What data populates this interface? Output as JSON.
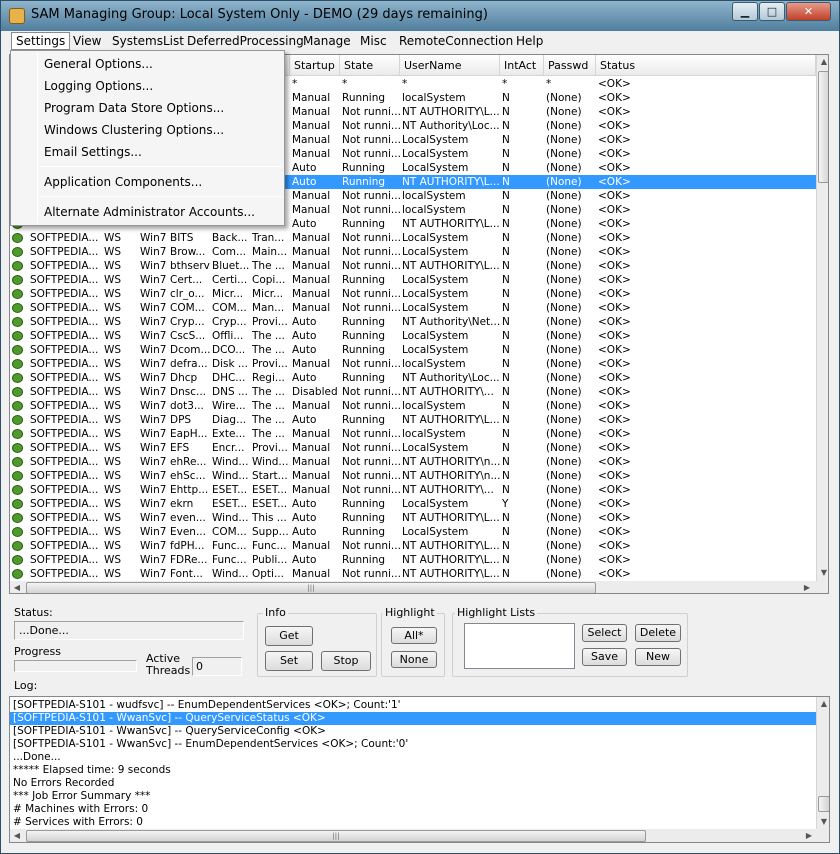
{
  "window": {
    "title": "SAM Managing Group: Local System Only - DEMO (29 days remaining)",
    "minimize": "▁",
    "maximize": "□",
    "close": "✕"
  },
  "menubar": [
    "Settings",
    "View",
    "SystemsList",
    "DeferredProcessing",
    "Manage",
    "Misc",
    "RemoteConnection",
    "Help"
  ],
  "settings_menu": [
    "General Options...",
    "Logging Options...",
    "Program Data Store Options...",
    "Windows Clustering Options...",
    "Email Settings...",
    "Application Components...",
    "Alternate Administrator Accounts..."
  ],
  "grid": {
    "columns": [
      "",
      "",
      "",
      "",
      "",
      "",
      "Startup",
      "State",
      "UserName",
      "IntAct",
      "Passwd",
      "Status"
    ],
    "filter_row": [
      "",
      "",
      "",
      "",
      "",
      "",
      "*",
      "*",
      "*",
      "*",
      "*",
      "<OK>"
    ],
    "rows": [
      [
        "",
        "",
        "",
        "",
        "",
        "",
        "Manual",
        "Running",
        "localSystem",
        "N",
        "(None)",
        "<OK>"
      ],
      [
        "",
        "",
        "",
        "",
        "",
        "",
        "Manual",
        "Not runni...",
        "NT AUTHORITY\\L...",
        "N",
        "(None)",
        "<OK>"
      ],
      [
        "",
        "",
        "",
        "",
        "",
        "",
        "Manual",
        "Not runni...",
        "NT Authority\\Loc...",
        "N",
        "(None)",
        "<OK>"
      ],
      [
        "",
        "",
        "",
        "",
        "",
        "",
        "Manual",
        "Not runni...",
        "LocalSystem",
        "N",
        "(None)",
        "<OK>"
      ],
      [
        "",
        "",
        "",
        "",
        "",
        "",
        "Manual",
        "Not runni...",
        "LocalSystem",
        "N",
        "(None)",
        "<OK>"
      ],
      [
        "",
        "",
        "",
        "",
        "",
        "",
        "Auto",
        "Running",
        "LocalSystem",
        "N",
        "(None)",
        "<OK>"
      ],
      [
        "",
        "",
        "",
        "",
        "",
        "",
        "Auto",
        "Running",
        "NT AUTHORITY\\L...",
        "N",
        "(None)",
        "<OK>"
      ],
      [
        "",
        "",
        "",
        "",
        "",
        "",
        "Manual",
        "Not runni...",
        "localSystem",
        "N",
        "(None)",
        "<OK>"
      ],
      [
        "",
        "",
        "",
        "",
        "",
        "",
        "Manual",
        "Not runni...",
        "localSystem",
        "N",
        "(None)",
        "<OK>"
      ],
      [
        "",
        "",
        "",
        "",
        "",
        "",
        "Auto",
        "Running",
        "NT AUTHORITY\\L...",
        "N",
        "(None)",
        "<OK>"
      ],
      [
        "SOFTPEDIA...",
        "WS",
        "Win7",
        "BITS",
        "Back...",
        "Tran...",
        "Manual",
        "Not runni...",
        "LocalSystem",
        "N",
        "(None)",
        "<OK>"
      ],
      [
        "SOFTPEDIA...",
        "WS",
        "Win7",
        "Brow...",
        "Com...",
        "Main...",
        "Manual",
        "Not runni...",
        "LocalSystem",
        "N",
        "(None)",
        "<OK>"
      ],
      [
        "SOFTPEDIA...",
        "WS",
        "Win7",
        "bthserv",
        "Bluet...",
        "The ...",
        "Manual",
        "Not runni...",
        "NT AUTHORITY\\L...",
        "N",
        "(None)",
        "<OK>"
      ],
      [
        "SOFTPEDIA...",
        "WS",
        "Win7",
        "Cert...",
        "Certi...",
        "Copi...",
        "Manual",
        "Running",
        "LocalSystem",
        "N",
        "(None)",
        "<OK>"
      ],
      [
        "SOFTPEDIA...",
        "WS",
        "Win7",
        "clr_o...",
        "Micr...",
        "Micr...",
        "Manual",
        "Not runni...",
        "LocalSystem",
        "N",
        "(None)",
        "<OK>"
      ],
      [
        "SOFTPEDIA...",
        "WS",
        "Win7",
        "COM...",
        "COM...",
        "Man...",
        "Manual",
        "Not runni...",
        "LocalSystem",
        "N",
        "(None)",
        "<OK>"
      ],
      [
        "SOFTPEDIA...",
        "WS",
        "Win7",
        "Cryp...",
        "Cryp...",
        "Provi...",
        "Auto",
        "Running",
        "NT Authority\\Net...",
        "N",
        "(None)",
        "<OK>"
      ],
      [
        "SOFTPEDIA...",
        "WS",
        "Win7",
        "CscS...",
        "Offli...",
        "The ...",
        "Auto",
        "Running",
        "LocalSystem",
        "N",
        "(None)",
        "<OK>"
      ],
      [
        "SOFTPEDIA...",
        "WS",
        "Win7",
        "Dcom...",
        "DCO...",
        "The ...",
        "Auto",
        "Running",
        "LocalSystem",
        "N",
        "(None)",
        "<OK>"
      ],
      [
        "SOFTPEDIA...",
        "WS",
        "Win7",
        "defra...",
        "Disk ...",
        "Provi...",
        "Manual",
        "Not runni...",
        "localSystem",
        "N",
        "(None)",
        "<OK>"
      ],
      [
        "SOFTPEDIA...",
        "WS",
        "Win7",
        "Dhcp",
        "DHC...",
        "Regi...",
        "Auto",
        "Running",
        "NT Authority\\Loc...",
        "N",
        "(None)",
        "<OK>"
      ],
      [
        "SOFTPEDIA...",
        "WS",
        "Win7",
        "Dnsc...",
        "DNS ...",
        "The ...",
        "Disabled",
        "Not runni...",
        "NT AUTHORITY\\...",
        "N",
        "(None)",
        "<OK>"
      ],
      [
        "SOFTPEDIA...",
        "WS",
        "Win7",
        "dot3...",
        "Wire...",
        "The ...",
        "Manual",
        "Not runni...",
        "localSystem",
        "N",
        "(None)",
        "<OK>"
      ],
      [
        "SOFTPEDIA...",
        "WS",
        "Win7",
        "DPS",
        "Diag...",
        "The ...",
        "Auto",
        "Running",
        "NT AUTHORITY\\L...",
        "N",
        "(None)",
        "<OK>"
      ],
      [
        "SOFTPEDIA...",
        "WS",
        "Win7",
        "EapH...",
        "Exte...",
        "The ...",
        "Manual",
        "Not runni...",
        "localSystem",
        "N",
        "(None)",
        "<OK>"
      ],
      [
        "SOFTPEDIA...",
        "WS",
        "Win7",
        "EFS",
        "Encr...",
        "Provi...",
        "Manual",
        "Not runni...",
        "LocalSystem",
        "N",
        "(None)",
        "<OK>"
      ],
      [
        "SOFTPEDIA...",
        "WS",
        "Win7",
        "ehRe...",
        "Wind...",
        "Wind...",
        "Manual",
        "Not runni...",
        "NT AUTHORITY\\n...",
        "N",
        "(None)",
        "<OK>"
      ],
      [
        "SOFTPEDIA...",
        "WS",
        "Win7",
        "ehSc...",
        "Wind...",
        "Start...",
        "Manual",
        "Not runni...",
        "NT AUTHORITY\\n...",
        "N",
        "(None)",
        "<OK>"
      ],
      [
        "SOFTPEDIA...",
        "WS",
        "Win7",
        "Ehttp...",
        "ESET...",
        "ESET...",
        "Manual",
        "Not runni...",
        "NT AUTHORITY\\...",
        "N",
        "(None)",
        "<OK>"
      ],
      [
        "SOFTPEDIA...",
        "WS",
        "Win7",
        "ekrn",
        "ESET...",
        "ESET...",
        "Auto",
        "Running",
        "LocalSystem",
        "Y",
        "(None)",
        "<OK>"
      ],
      [
        "SOFTPEDIA...",
        "WS",
        "Win7",
        "even...",
        "Wind...",
        "This ...",
        "Auto",
        "Running",
        "NT AUTHORITY\\L...",
        "N",
        "(None)",
        "<OK>"
      ],
      [
        "SOFTPEDIA...",
        "WS",
        "Win7",
        "Even...",
        "COM...",
        "Supp...",
        "Auto",
        "Running",
        "LocalSystem",
        "N",
        "(None)",
        "<OK>"
      ],
      [
        "SOFTPEDIA...",
        "WS",
        "Win7",
        "fdPH...",
        "Func...",
        "Func...",
        "Manual",
        "Not runni...",
        "NT AUTHORITY\\L...",
        "N",
        "(None)",
        "<OK>"
      ],
      [
        "SOFTPEDIA...",
        "WS",
        "Win7",
        "FDRe...",
        "Func...",
        "Publi...",
        "Auto",
        "Running",
        "NT AUTHORITY\\L...",
        "N",
        "(None)",
        "<OK>"
      ],
      [
        "SOFTPEDIA...",
        "WS",
        "Win7",
        "Font...",
        "Wind...",
        "Opti...",
        "Manual",
        "Not runni...",
        "NT AUTHORITY\\L...",
        "N",
        "(None)",
        "<OK>"
      ]
    ]
  },
  "status_panel": {
    "status_label": "Status:",
    "status_value": "...Done...",
    "progress_label": "Progress",
    "progress_fraction": 0,
    "active_threads_label": "Active Threads",
    "active_threads_value": "0",
    "log_label": "Log:"
  },
  "info": {
    "legend": "Info",
    "get": "Get",
    "set": "Set",
    "stop": "Stop"
  },
  "highlight": {
    "legend": "Highlight",
    "all": "All*",
    "none": "None"
  },
  "highlight_lists": {
    "legend": "Highlight Lists",
    "select": "Select",
    "delete": "Delete",
    "save": "Save",
    "new": "New"
  },
  "log_lines": [
    "[SOFTPEDIA-S101 - wudfsvc] -- EnumDependentServices <OK>; Count:'1'",
    "[SOFTPEDIA-S101 - WwanSvc] -- QueryServiceStatus <OK>",
    "[SOFTPEDIA-S101 - WwanSvc] -- QueryServiceConfig <OK>",
    "[SOFTPEDIA-S101 - WwanSvc] -- EnumDependentServices <OK>; Count:'0'",
    "...Done...",
    "***** Elapsed time: 9 seconds",
    "No Errors Recorded",
    "*** Job Error Summary ***",
    "# Machines with Errors: 0",
    "# Services with Errors: 0"
  ],
  "colors": {
    "selection": "#3399ff",
    "service_icon": "#4f9a2c",
    "title_gradient_top": "#8fb4cc"
  }
}
